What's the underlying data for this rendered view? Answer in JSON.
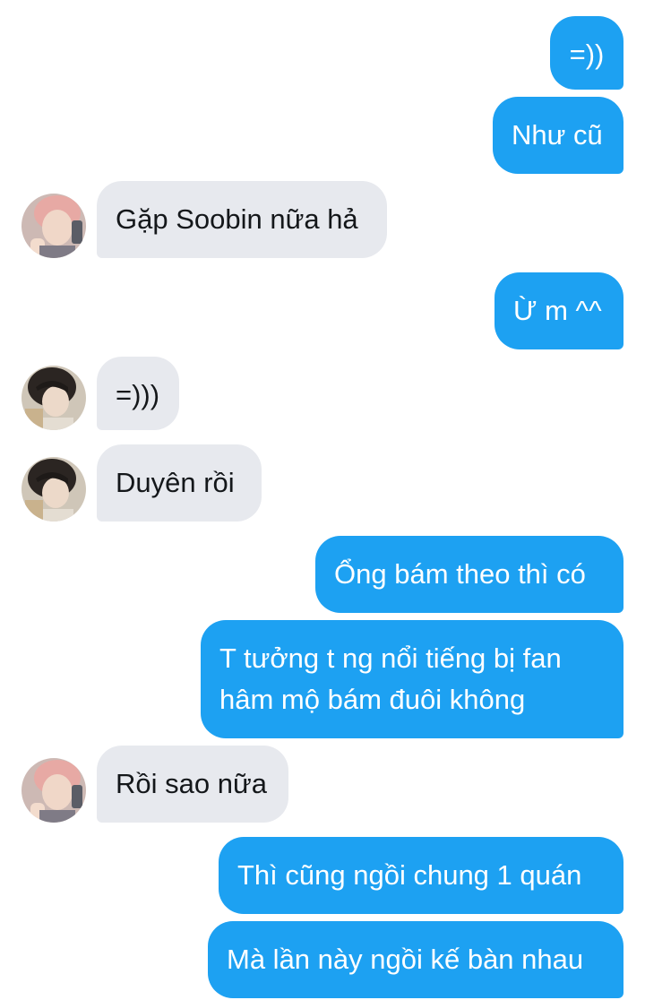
{
  "messages": [
    {
      "side": "out",
      "text": "=))"
    },
    {
      "side": "out",
      "text": "Như cũ"
    },
    {
      "side": "in",
      "avatar": "avatar-pink-hair",
      "text": "Gặp Soobin nữa hả"
    },
    {
      "side": "out",
      "text": "Ừ m ^^"
    },
    {
      "side": "in",
      "avatar": "avatar-dark-hair",
      "text": "=)))"
    },
    {
      "side": "in",
      "avatar": "avatar-dark-hair",
      "text": "Duyên rồi"
    },
    {
      "side": "out",
      "text": "Ổng bám theo thì có"
    },
    {
      "side": "out",
      "text": "T tưởng t ng nổi tiếng bị fan hâm mộ bám đuôi không"
    },
    {
      "side": "in",
      "avatar": "avatar-pink-hair",
      "text": "Rồi sao nữa"
    },
    {
      "side": "out",
      "text": "Thì cũng ngồi chung 1 quán"
    },
    {
      "side": "out",
      "text": "Mà lần này ngồi kế bàn nhau"
    }
  ],
  "colors": {
    "outgoing_bubble": "#1da1f2",
    "incoming_bubble": "#e7e9ee",
    "outgoing_text": "#ffffff",
    "incoming_text": "#14171a"
  }
}
